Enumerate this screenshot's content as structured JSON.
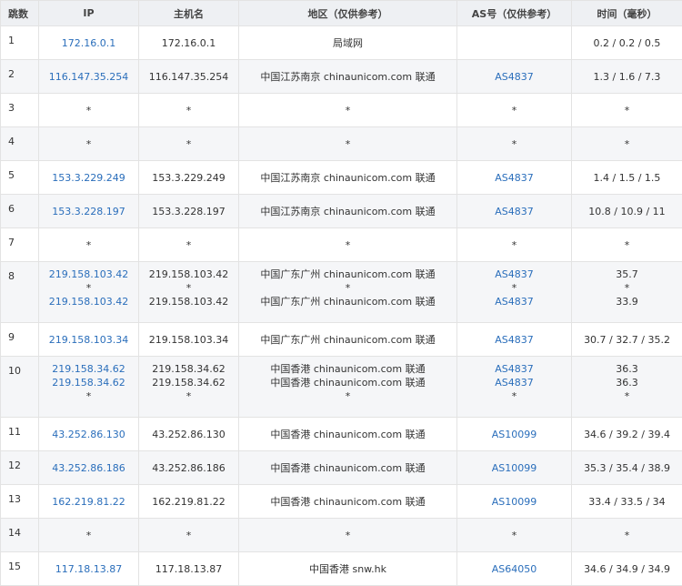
{
  "columns": [
    "跳数",
    "IP",
    "主机名",
    "地区（仅供参考）",
    "AS号（仅供参考）",
    "时间（毫秒）"
  ],
  "rows": [
    {
      "hop": "1",
      "ip": [
        "172.16.0.1"
      ],
      "host": [
        "172.16.0.1"
      ],
      "region": [
        "局域网"
      ],
      "as": [
        ""
      ],
      "time": [
        "0.2 / 0.2 / 0.5"
      ]
    },
    {
      "hop": "2",
      "ip": [
        "116.147.35.254"
      ],
      "host": [
        "116.147.35.254"
      ],
      "region": [
        "中国江苏南京 chinaunicom.com 联通"
      ],
      "as": [
        "AS4837"
      ],
      "time": [
        "1.3 / 1.6 / 7.3"
      ]
    },
    {
      "hop": "3",
      "ip": [
        "*"
      ],
      "host": [
        "*"
      ],
      "region": [
        "*"
      ],
      "as": [
        "*"
      ],
      "time": [
        "*"
      ]
    },
    {
      "hop": "4",
      "ip": [
        "*"
      ],
      "host": [
        "*"
      ],
      "region": [
        "*"
      ],
      "as": [
        "*"
      ],
      "time": [
        "*"
      ]
    },
    {
      "hop": "5",
      "ip": [
        "153.3.229.249"
      ],
      "host": [
        "153.3.229.249"
      ],
      "region": [
        "中国江苏南京 chinaunicom.com 联通"
      ],
      "as": [
        "AS4837"
      ],
      "time": [
        "1.4 / 1.5 / 1.5"
      ]
    },
    {
      "hop": "6",
      "ip": [
        "153.3.228.197"
      ],
      "host": [
        "153.3.228.197"
      ],
      "region": [
        "中国江苏南京 chinaunicom.com 联通"
      ],
      "as": [
        "AS4837"
      ],
      "time": [
        "10.8 / 10.9 / 11"
      ]
    },
    {
      "hop": "7",
      "ip": [
        "*"
      ],
      "host": [
        "*"
      ],
      "region": [
        "*"
      ],
      "as": [
        "*"
      ],
      "time": [
        "*"
      ]
    },
    {
      "hop": "8",
      "ip": [
        "219.158.103.42",
        "*",
        "219.158.103.42"
      ],
      "host": [
        "219.158.103.42",
        "*",
        "219.158.103.42"
      ],
      "region": [
        "中国广东广州 chinaunicom.com 联通",
        "*",
        "中国广东广州 chinaunicom.com 联通"
      ],
      "as": [
        "AS4837",
        "*",
        "AS4837"
      ],
      "time": [
        "35.7",
        "*",
        "33.9"
      ]
    },
    {
      "hop": "9",
      "ip": [
        "219.158.103.34"
      ],
      "host": [
        "219.158.103.34"
      ],
      "region": [
        "中国广东广州 chinaunicom.com 联通"
      ],
      "as": [
        "AS4837"
      ],
      "time": [
        "30.7 / 32.7 / 35.2"
      ]
    },
    {
      "hop": "10",
      "ip": [
        "219.158.34.62",
        "219.158.34.62",
        "*"
      ],
      "host": [
        "219.158.34.62",
        "219.158.34.62",
        "*"
      ],
      "region": [
        "中国香港 chinaunicom.com 联通",
        "中国香港 chinaunicom.com 联通",
        "*"
      ],
      "as": [
        "AS4837",
        "AS4837",
        "*"
      ],
      "time": [
        "36.3",
        "36.3",
        "*"
      ]
    },
    {
      "hop": "11",
      "ip": [
        "43.252.86.130"
      ],
      "host": [
        "43.252.86.130"
      ],
      "region": [
        "中国香港 chinaunicom.com 联通"
      ],
      "as": [
        "AS10099"
      ],
      "time": [
        "34.6 / 39.2 / 39.4"
      ]
    },
    {
      "hop": "12",
      "ip": [
        "43.252.86.186"
      ],
      "host": [
        "43.252.86.186"
      ],
      "region": [
        "中国香港 chinaunicom.com 联通"
      ],
      "as": [
        "AS10099"
      ],
      "time": [
        "35.3 / 35.4 / 38.9"
      ]
    },
    {
      "hop": "13",
      "ip": [
        "162.219.81.22"
      ],
      "host": [
        "162.219.81.22"
      ],
      "region": [
        "中国香港 chinaunicom.com 联通"
      ],
      "as": [
        "AS10099"
      ],
      "time": [
        "33.4 / 33.5 / 34"
      ]
    },
    {
      "hop": "14",
      "ip": [
        "*"
      ],
      "host": [
        "*"
      ],
      "region": [
        "*"
      ],
      "as": [
        "*"
      ],
      "time": [
        "*"
      ]
    },
    {
      "hop": "15",
      "ip": [
        "117.18.13.87"
      ],
      "host": [
        "117.18.13.87"
      ],
      "region": [
        "中国香港 snw.hk"
      ],
      "as": [
        "AS64050"
      ],
      "time": [
        "34.6 / 34.9 / 34.9"
      ]
    }
  ],
  "colors": {
    "link": "#2a6ebb",
    "header_bg": "#eef0f3",
    "row_alt_bg": "#f5f6f8",
    "border": "#e3e3e3"
  }
}
